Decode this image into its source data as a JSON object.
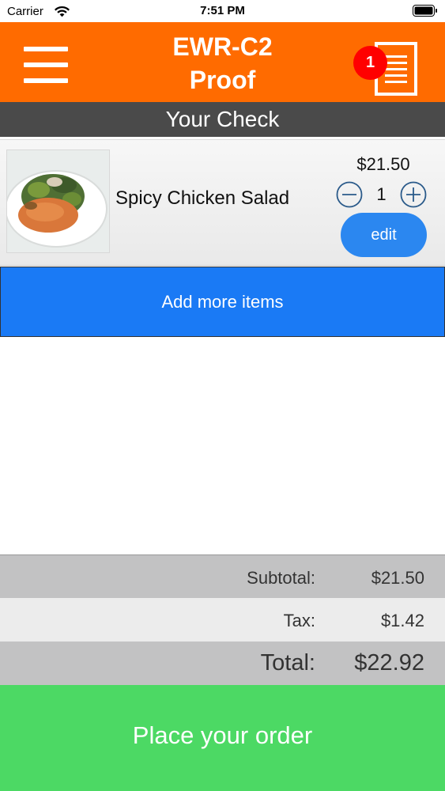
{
  "status_bar": {
    "carrier": "Carrier",
    "time": "7:51 PM"
  },
  "header": {
    "title_line1": "EWR-C2",
    "title_line2": "Proof",
    "check_badge_count": "1",
    "background_color": "#ff6b00"
  },
  "section": {
    "title": "Your Check"
  },
  "items": [
    {
      "name": "Spicy Chicken Salad",
      "price": "$21.50",
      "quantity": "1",
      "edit_label": "edit"
    }
  ],
  "actions": {
    "add_more_label": "Add more items",
    "place_order_label": "Place your order"
  },
  "totals": {
    "subtotal_label": "Subtotal:",
    "subtotal_value": "$21.50",
    "tax_label": "Tax:",
    "tax_value": "$1.42",
    "total_label": "Total:",
    "total_value": "$22.92"
  },
  "icons": {
    "menu": "hamburger-menu-icon",
    "check": "receipt-icon",
    "minus": "minus-circle-icon",
    "plus": "plus-circle-icon"
  },
  "colors": {
    "accent_blue": "#1a7af5",
    "edit_blue": "#2b87f0",
    "order_green": "#4cd964",
    "badge_red": "#ff0000"
  }
}
